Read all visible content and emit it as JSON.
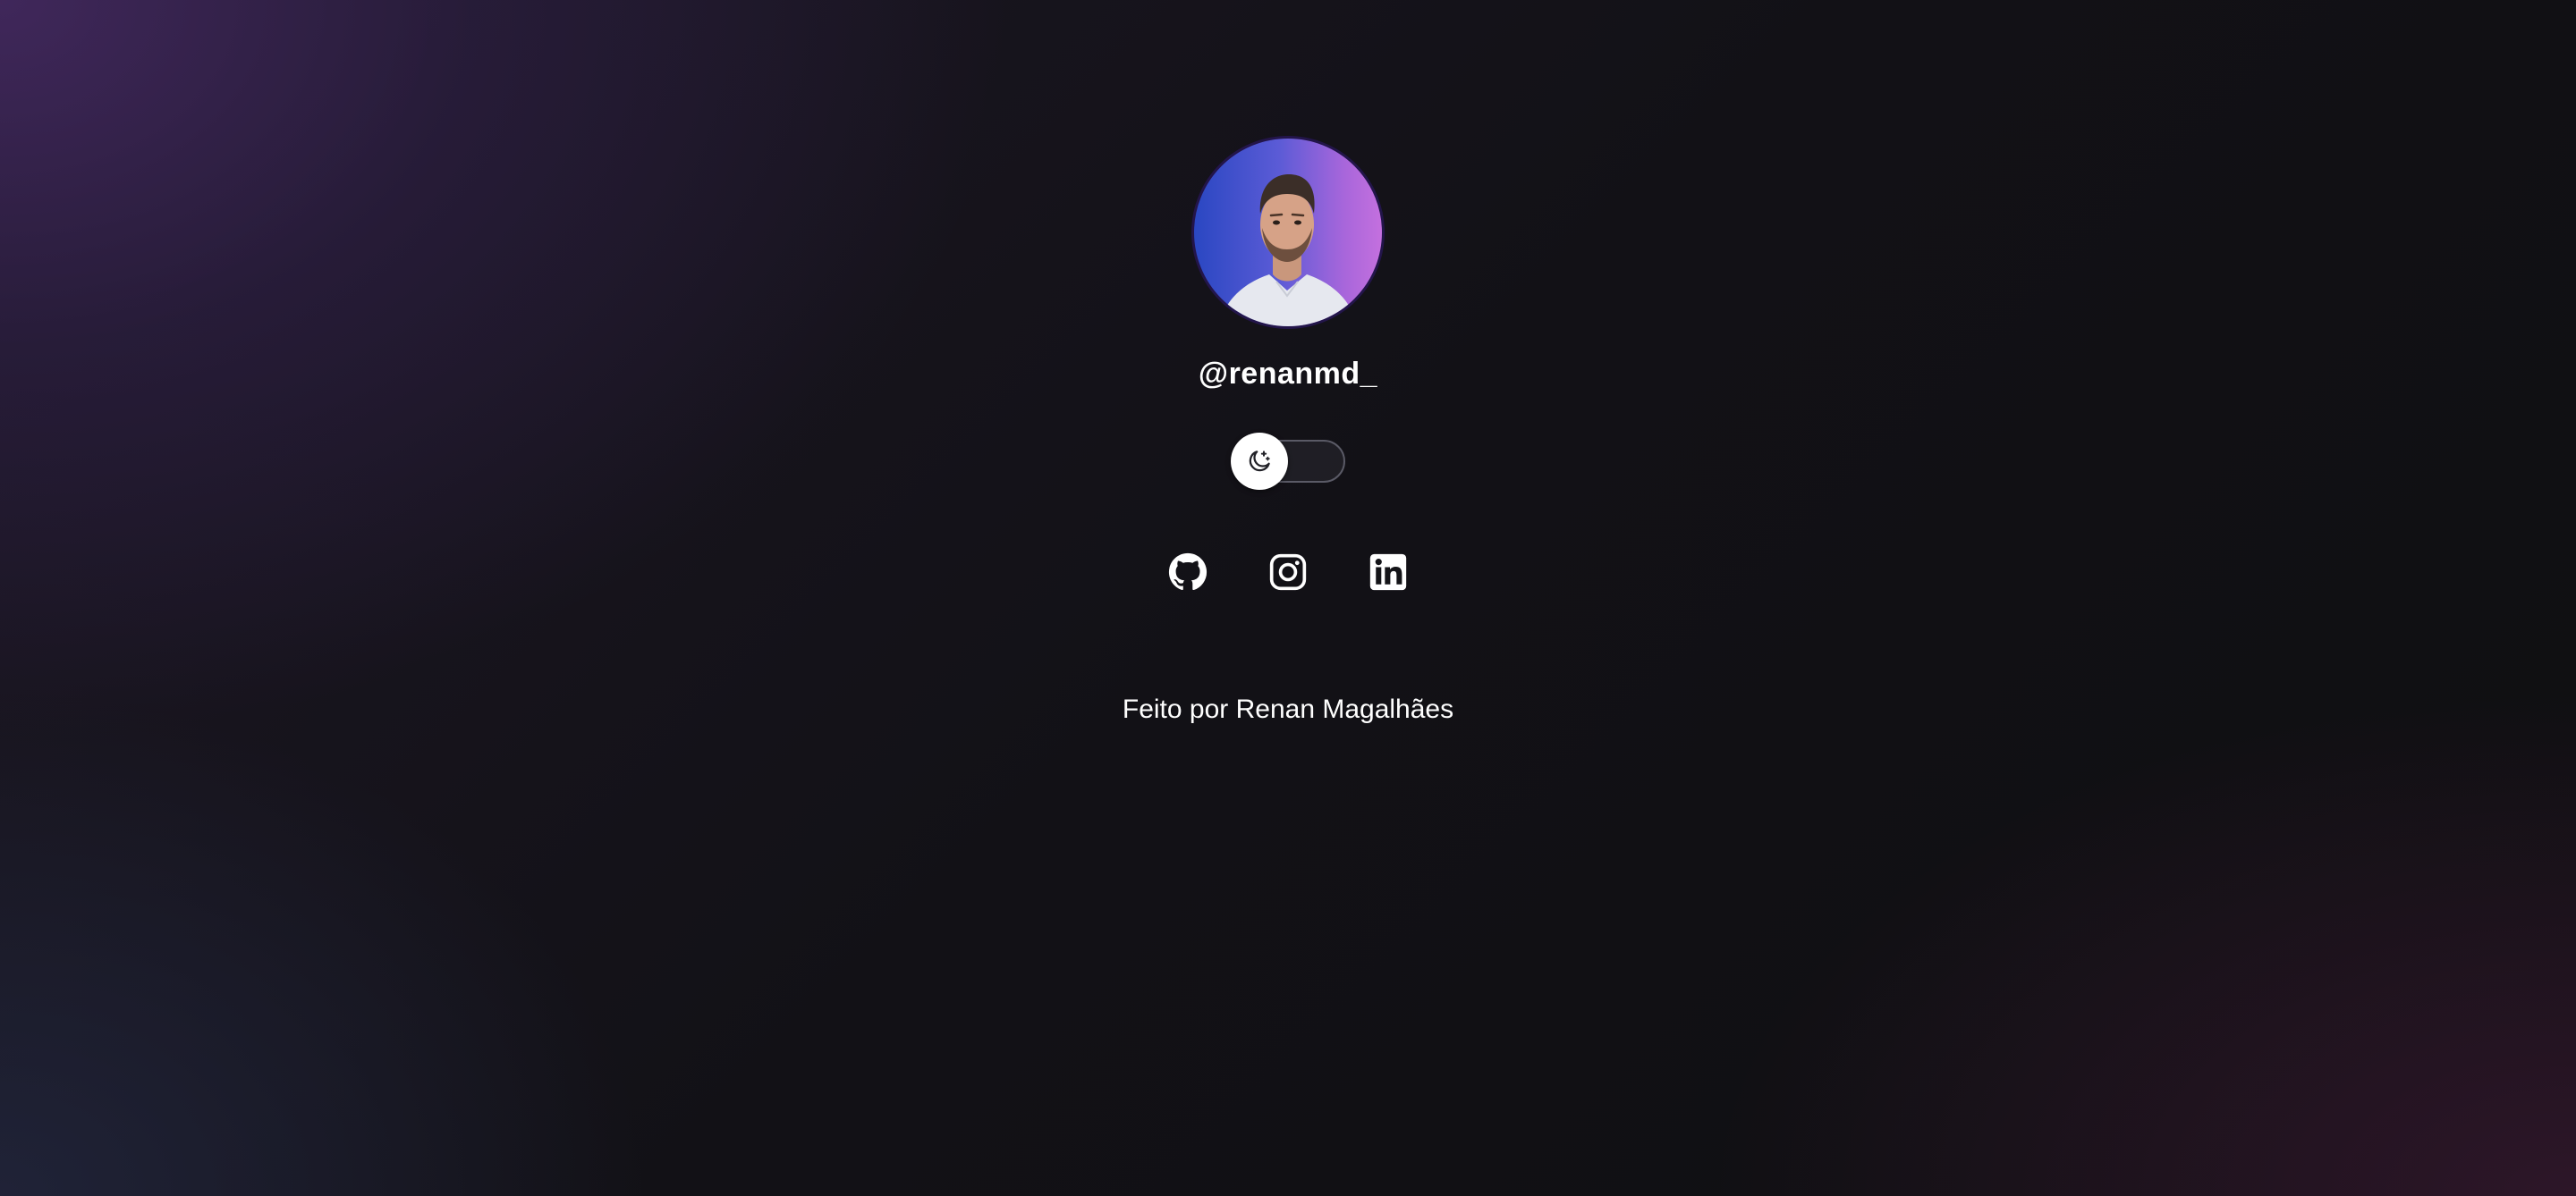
{
  "profile": {
    "avatar_alt": "profile photo",
    "handle": "@renanmd_"
  },
  "theme_toggle": {
    "icon": "moon-stars-icon",
    "state": "dark"
  },
  "socials": [
    {
      "name": "GitHub",
      "icon": "github-icon"
    },
    {
      "name": "Instagram",
      "icon": "instagram-icon"
    },
    {
      "name": "LinkedIn",
      "icon": "linkedin-icon"
    }
  ],
  "footer": {
    "text": "Feito por Renan Magalhães"
  },
  "colors": {
    "background": "#111114",
    "text": "#ffffff",
    "avatar_gradient_start": "#2a47c2",
    "avatar_gradient_end": "#c470de"
  }
}
